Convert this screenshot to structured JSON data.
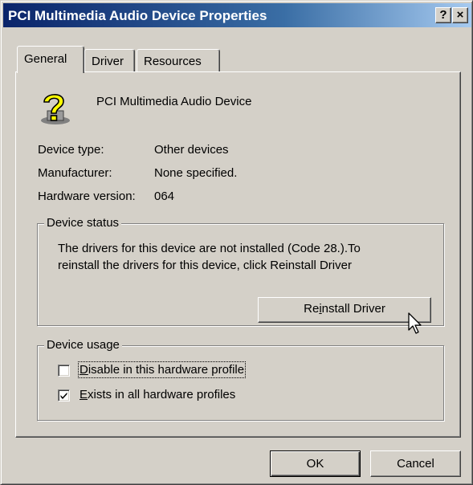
{
  "window": {
    "title": "PCI Multimedia Audio Device Properties",
    "help_button": "?",
    "close_button": "×"
  },
  "tabs": [
    {
      "label": "General",
      "active": true
    },
    {
      "label": "Driver",
      "active": false
    },
    {
      "label": "Resources",
      "active": false
    }
  ],
  "device": {
    "name": "PCI Multimedia Audio Device",
    "icon": "question-mark-device-icon",
    "type_label": "Device type:",
    "type_value": "Other devices",
    "manufacturer_label": "Manufacturer:",
    "manufacturer_value": "None specified.",
    "hardware_version_label": "Hardware version:",
    "hardware_version_value": "064"
  },
  "device_status": {
    "title": "Device status",
    "message_line1": "The drivers for this device are not installed  (Code 28.).To",
    "message_line2": "reinstall the drivers for this device, click Reinstall Driver",
    "reinstall_button": {
      "pre": "Re",
      "underlined": "i",
      "post": "nstall Driver"
    }
  },
  "device_usage": {
    "title": "Device usage",
    "disable_option": {
      "underlined": "D",
      "rest": "isable in this hardware profile",
      "checked": false
    },
    "exists_option": {
      "underlined": "E",
      "rest": "xists in all hardware profiles",
      "checked": true
    }
  },
  "footer": {
    "ok_label": "OK",
    "cancel_label": "Cancel"
  },
  "colors": {
    "face": "#d4d0c8",
    "title_start": "#0a246a",
    "title_end": "#a6caf0"
  }
}
